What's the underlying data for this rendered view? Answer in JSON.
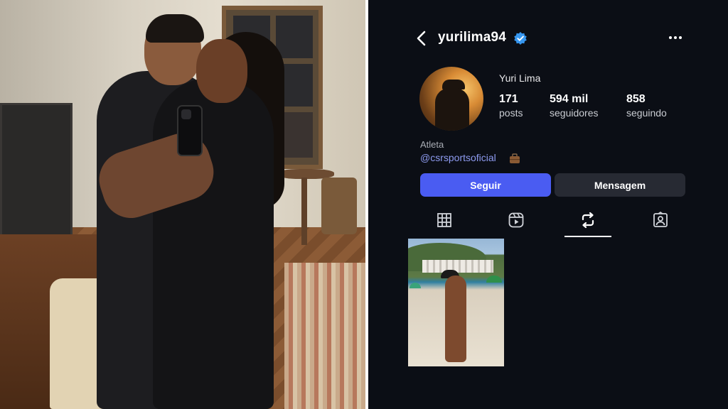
{
  "profile": {
    "username": "yurilima94",
    "full_name": "Yuri Lima",
    "verified": true,
    "stats": {
      "posts_count": "171",
      "posts_label": "posts",
      "followers_count": "594 mil",
      "followers_label": "seguidores",
      "following_count": "858",
      "following_label": "seguindo"
    },
    "bio": {
      "category": "Atleta",
      "link": "@csrsportsoficial",
      "link_emoji_icon": "briefcase-icon"
    },
    "buttons": {
      "follow_label": "Seguir",
      "message_label": "Mensagem"
    },
    "tabs": [
      {
        "icon": "grid-icon",
        "active": false
      },
      {
        "icon": "reels-icon",
        "active": false
      },
      {
        "icon": "reposts-icon",
        "active": true
      },
      {
        "icon": "tagged-icon",
        "active": false
      }
    ]
  },
  "colors": {
    "background": "#0b0e15",
    "accent": "#4a5cf2",
    "secondary_button": "#272a33",
    "link": "#8e9bf0",
    "verified": "#3797f0"
  }
}
